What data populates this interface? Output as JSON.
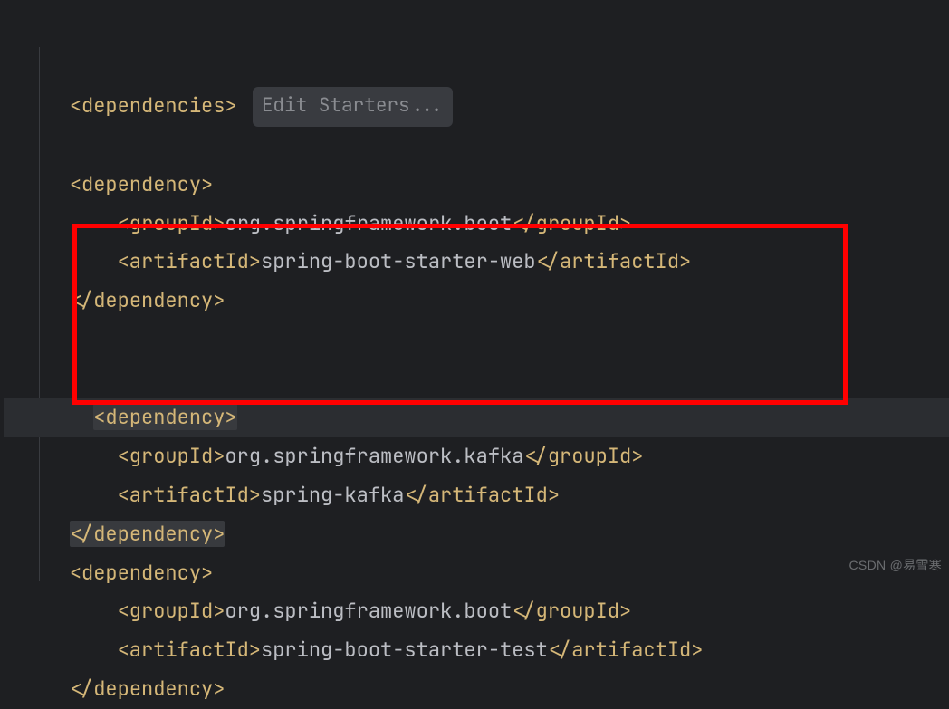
{
  "hint": "Edit Starters...",
  "tags": {
    "dependencies_open": "<dependencies>",
    "dependency_open": "<dependency>",
    "dependency_close": "</dependency>",
    "groupId_open": "<groupId>",
    "groupId_close": "</groupId>",
    "artifactId_open": "<artifactId>",
    "artifactId_close": "</artifactId>"
  },
  "deps": [
    {
      "groupId": "org.springframework.boot",
      "artifactId": "spring-boot-starter-web"
    },
    {
      "groupId": "org.springframework.kafka",
      "artifactId": "spring-kafka"
    },
    {
      "groupId": "org.springframework.boot",
      "artifactId": "spring-boot-starter-test"
    }
  ],
  "watermark": "CSDN @易雪寒"
}
